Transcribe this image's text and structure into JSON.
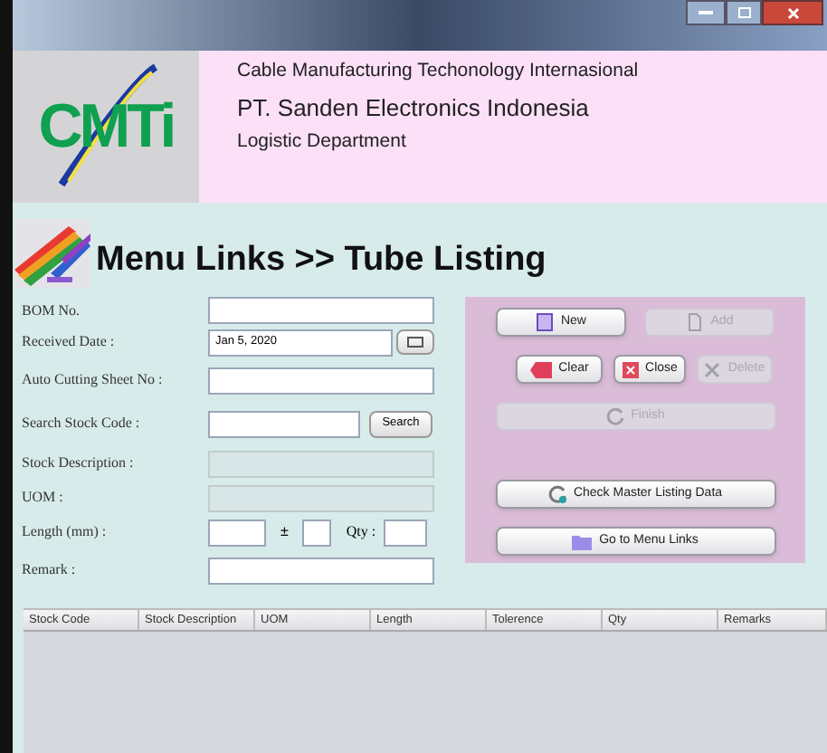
{
  "header": {
    "logo_text": "CMTi",
    "lines": [
      "Cable Manufacturing Techonology Internasional",
      "PT. Sanden Electronics Indonesia",
      "Logistic Department"
    ]
  },
  "page_title": "Menu Links  >> Tube Listing",
  "form": {
    "bom_no": {
      "label": "BOM No."
    },
    "received_date": {
      "label": "Received Date :",
      "value": "Jan 5, 2020"
    },
    "auto_cutting_sheet": {
      "label": "Auto Cutting Sheet No :"
    },
    "search_stock_code": {
      "label": "Search Stock Code :",
      "button": "Search"
    },
    "stock_description": {
      "label": "Stock Description :",
      "disabled": true
    },
    "uom": {
      "label": "UOM :",
      "disabled": true
    },
    "length": {
      "label": "Length (mm) :",
      "plus_minus": "±",
      "qty_label": "Qty :"
    },
    "remark": {
      "label": "Remark :"
    }
  },
  "actions": [
    {
      "label": "New",
      "disabled": false
    },
    {
      "label": "Add",
      "disabled": true
    },
    {
      "label": "Clear",
      "disabled": false
    },
    {
      "label": "Close",
      "disabled": false
    },
    {
      "label": "Delete",
      "disabled": true
    },
    {
      "label": "Finish",
      "disabled": true
    },
    {
      "label": "Check Master Listing Data",
      "disabled": false
    },
    {
      "label": "Go to Menu Links",
      "disabled": false
    }
  ],
  "table": {
    "columns": [
      "Stock Code",
      "Stock Description",
      "UOM",
      "Length",
      "Tolerence",
      "Qty",
      "Remarks"
    ]
  }
}
